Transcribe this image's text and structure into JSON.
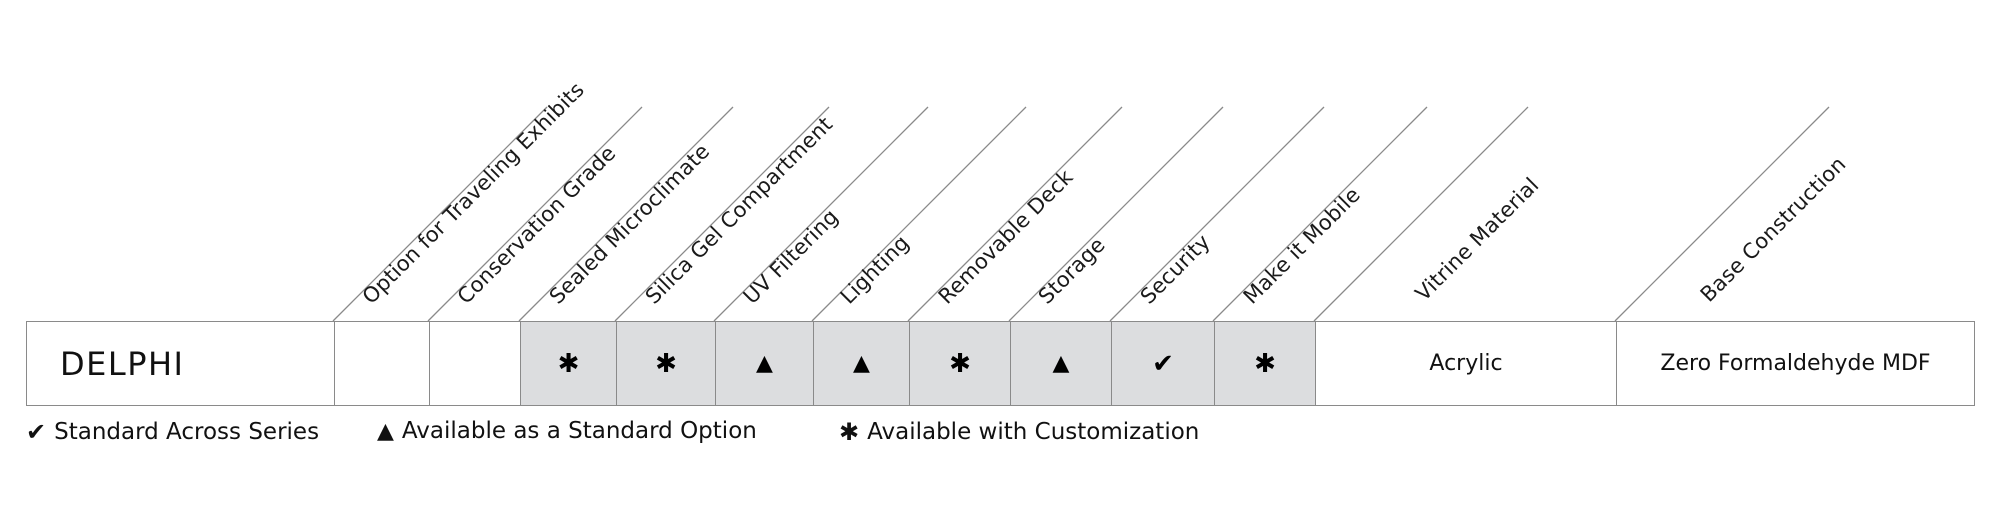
{
  "product": {
    "name": "DELPHI"
  },
  "columns": [
    {
      "label": "Option for Traveling Exhibits",
      "value": "",
      "kind": "empty"
    },
    {
      "label": "Conservation Grade",
      "value": "",
      "kind": "empty"
    },
    {
      "label": "Sealed Microclimate",
      "value": "✱",
      "kind": "customization"
    },
    {
      "label": "Silica Gel Compartment",
      "value": "✱",
      "kind": "customization"
    },
    {
      "label": "UV Filtering",
      "value": "▲",
      "kind": "standard-option"
    },
    {
      "label": "Lighting",
      "value": "▲",
      "kind": "standard-option"
    },
    {
      "label": "Removable Deck",
      "value": "✱",
      "kind": "customization"
    },
    {
      "label": "Storage",
      "value": "▲",
      "kind": "standard-option"
    },
    {
      "label": "Security",
      "value": "✔",
      "kind": "standard-across-series"
    },
    {
      "label": "Make it Mobile",
      "value": "✱",
      "kind": "customization"
    },
    {
      "label": "Vitrine Material",
      "value": "Acrylic",
      "kind": "text"
    },
    {
      "label": "Base Construction",
      "value": "Zero Formaldehyde MDF",
      "kind": "text"
    }
  ],
  "legend": [
    {
      "symbol": "✔",
      "icon": "check-icon",
      "label": "Standard Across Series"
    },
    {
      "symbol": "▲",
      "icon": "triangle-icon",
      "label": "Available as a Standard Option"
    },
    {
      "symbol": "✱",
      "icon": "asterisk-icon",
      "label": "Available with Customization"
    }
  ],
  "colors": {
    "highlight_cell": "#dcdddf",
    "border": "#8a8a8a",
    "text": "#111111"
  }
}
